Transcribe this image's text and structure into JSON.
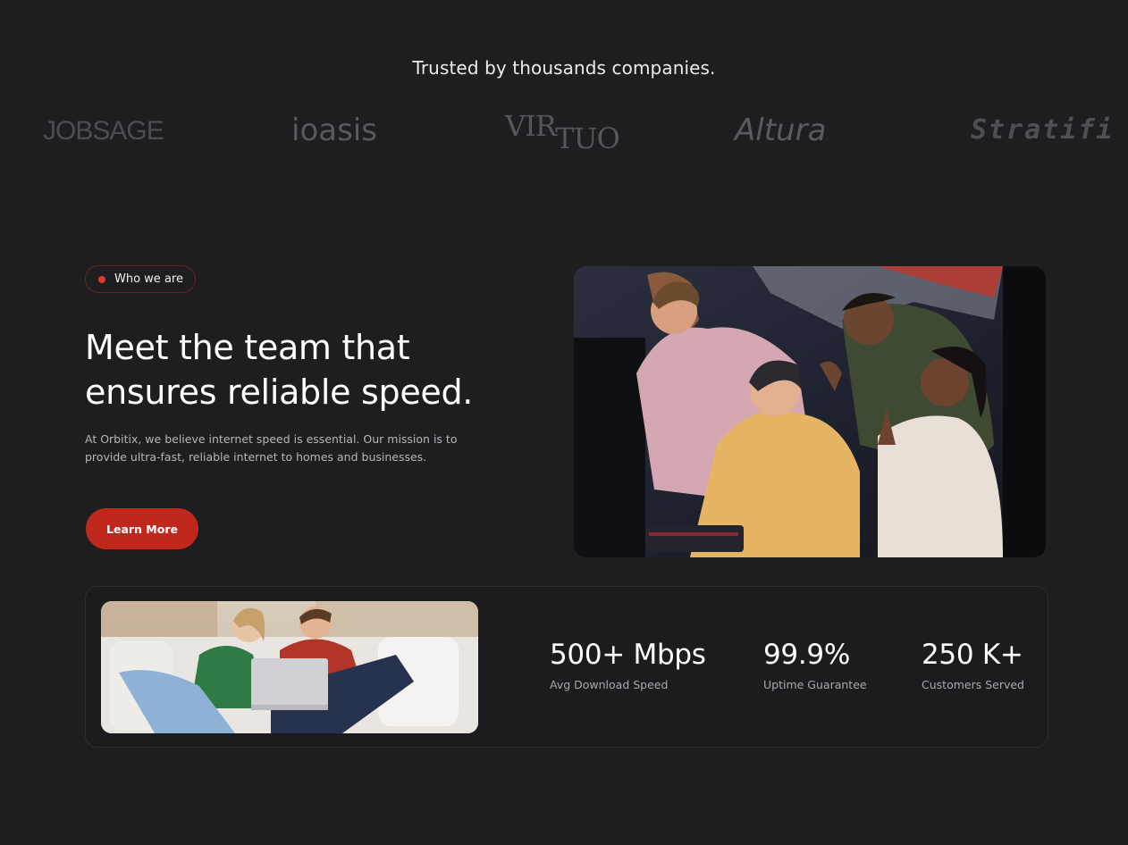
{
  "trusted": {
    "title": "Trusted by thousands companies."
  },
  "logos": {
    "jobsage": "JOBSAGE",
    "ioasis": "ioasis",
    "virtuo_a": "VIR",
    "virtuo_b": "TUO",
    "altura": "Altura",
    "stratifi": "Stratifi"
  },
  "about": {
    "badge_label": "Who we are",
    "badge_dot_color": "#e2382c",
    "headline_line1": "Meet the team that",
    "headline_line2": "ensures reliable speed.",
    "description": "At Orbitix, we believe internet speed is essential. Our mission is to provide ultra-fast, reliable internet to homes and businesses.",
    "cta_label": "Learn More",
    "cta_color": "#c0281d"
  },
  "stats": [
    {
      "value": "500+ Mbps",
      "label": "Avg Download Speed"
    },
    {
      "value": "99.9%",
      "label": "Uptime Guarantee"
    },
    {
      "value": "250 K+",
      "label": "Customers Served"
    }
  ]
}
